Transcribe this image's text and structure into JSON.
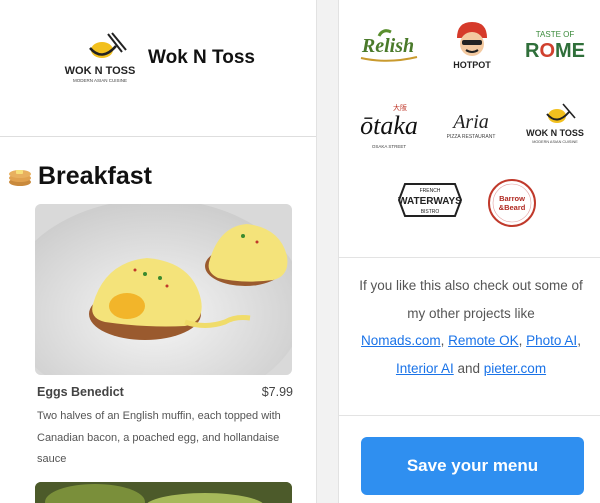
{
  "restaurant": {
    "name": "Wok N Toss",
    "logo_text": "WOK N TOSS",
    "logo_sub": "MODERN ASIAN CUISINE"
  },
  "section": {
    "title": "Breakfast",
    "emoji": "pancakes-icon"
  },
  "dish": {
    "name": "Eggs Benedict",
    "price": "$7.99",
    "description": "Two halves of an English muffin, each topped with Canadian bacon, a poached egg, and hollandaise sauce"
  },
  "example_logos": [
    {
      "name": "Relish"
    },
    {
      "name": "HOTPOT"
    },
    {
      "name": "TASTE OF ROME"
    },
    {
      "name": "Otaka"
    },
    {
      "name": "Aria"
    },
    {
      "name": "WOK N TOSS"
    },
    {
      "name": "WATERWAYS"
    },
    {
      "name": "Barrow & Beard"
    }
  ],
  "promo": {
    "line1": "If you like this also check out some of my other projects like",
    "links": [
      "Nomads.com",
      "Remote OK",
      "Photo AI",
      "Interior AI",
      "pieter.com"
    ],
    "and": "and"
  },
  "save_button": "Save your menu",
  "colors": {
    "accent": "#2f8ff0",
    "link": "#1a73e8"
  }
}
